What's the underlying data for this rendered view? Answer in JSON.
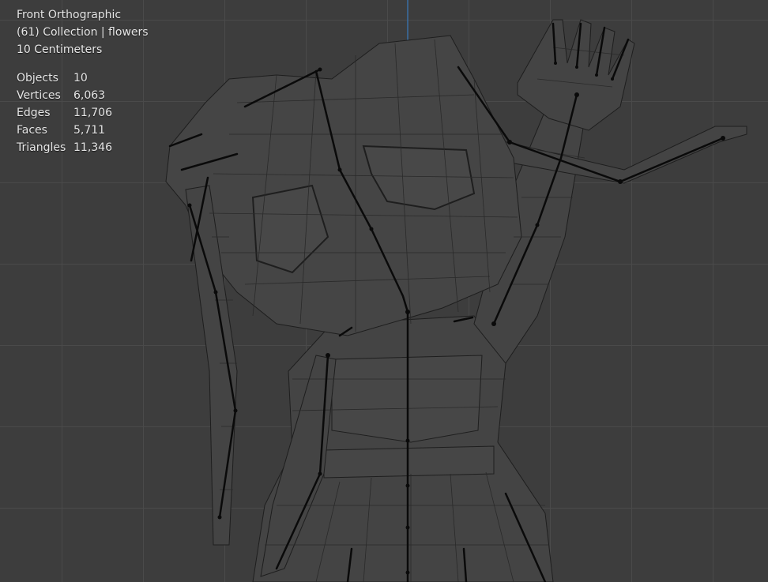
{
  "viewport": {
    "view_name": "Front Orthographic",
    "collection_info": "(61) Collection | flowers",
    "scale": "10 Centimeters"
  },
  "stats": [
    {
      "label": "Objects",
      "value": "10"
    },
    {
      "label": "Vertices",
      "value": "6,063"
    },
    {
      "label": "Edges",
      "value": "11,706"
    },
    {
      "label": "Faces",
      "value": "5,711"
    },
    {
      "label": "Triangles",
      "value": "11,346"
    }
  ],
  "colors": {
    "background": "#3d3d3d",
    "grid": "#4a4a4a",
    "mesh_fill": "#444444",
    "wire": "#1e1e1e",
    "bone": "#0a0a0a",
    "axis": "#3a6ea5",
    "text": "#e6e6e6"
  }
}
